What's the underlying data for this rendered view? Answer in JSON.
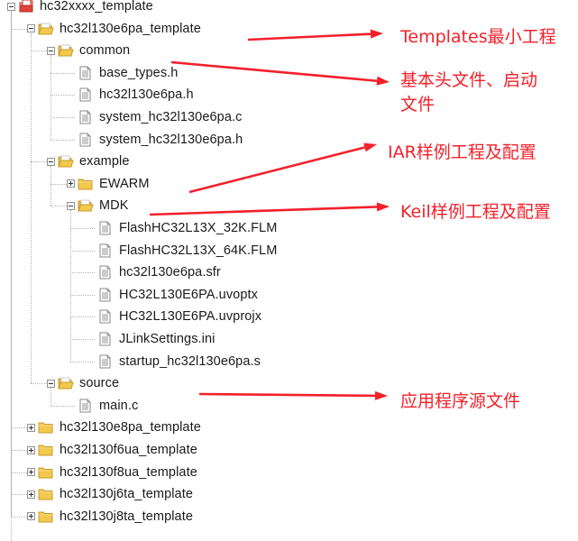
{
  "colors": {
    "annotation": "#f3202a",
    "folder": "#f2c94c",
    "root_icon": "#e0433a"
  },
  "tree": [
    {
      "label": "hc32xxxx_template",
      "level": 0,
      "icon": "project-icon",
      "expander": "minus"
    },
    {
      "label": "hc32l130e6pa_template",
      "level": 1,
      "icon": "folder-open-icon",
      "expander": "minus"
    },
    {
      "label": "common",
      "level": 2,
      "icon": "folder-open-icon",
      "expander": "minus"
    },
    {
      "label": "base_types.h",
      "level": 3,
      "icon": "file-icon"
    },
    {
      "label": "hc32l130e6pa.h",
      "level": 3,
      "icon": "file-icon"
    },
    {
      "label": "system_hc32l130e6pa.c",
      "level": 3,
      "icon": "file-icon"
    },
    {
      "label": "system_hc32l130e6pa.h",
      "level": 3,
      "icon": "file-icon"
    },
    {
      "label": "example",
      "level": 2,
      "icon": "folder-open-icon",
      "expander": "minus"
    },
    {
      "label": "EWARM",
      "level": 3,
      "icon": "folder-icon",
      "expander": "plus"
    },
    {
      "label": "MDK",
      "level": 3,
      "icon": "folder-open-icon",
      "expander": "minus"
    },
    {
      "label": "FlashHC32L13X_32K.FLM",
      "level": 4,
      "icon": "file-icon"
    },
    {
      "label": "FlashHC32L13X_64K.FLM",
      "level": 4,
      "icon": "file-icon"
    },
    {
      "label": "hc32l130e6pa.sfr",
      "level": 4,
      "icon": "file-icon"
    },
    {
      "label": "HC32L130E6PA.uvoptx",
      "level": 4,
      "icon": "file-icon"
    },
    {
      "label": "HC32L130E6PA.uvprojx",
      "level": 4,
      "icon": "file-icon"
    },
    {
      "label": "JLinkSettings.ini",
      "level": 4,
      "icon": "file-icon"
    },
    {
      "label": "startup_hc32l130e6pa.s",
      "level": 4,
      "icon": "file-icon"
    },
    {
      "label": "source",
      "level": 2,
      "icon": "folder-open-icon",
      "expander": "minus"
    },
    {
      "label": "main.c",
      "level": 3,
      "icon": "file-icon"
    },
    {
      "label": "hc32l130e8pa_template",
      "level": 1,
      "icon": "folder-icon",
      "expander": "plus"
    },
    {
      "label": "hc32l130f6ua_template",
      "level": 1,
      "icon": "folder-icon",
      "expander": "plus"
    },
    {
      "label": "hc32l130f8ua_template",
      "level": 1,
      "icon": "folder-icon",
      "expander": "plus"
    },
    {
      "label": "hc32l130j6ta_template",
      "level": 1,
      "icon": "folder-icon",
      "expander": "plus"
    },
    {
      "label": "hc32l130j8ta_template",
      "level": 1,
      "icon": "folder-icon",
      "expander": "plus"
    }
  ],
  "annotations": {
    "templates": "Templates最小工程",
    "common_line1": "基本头文件、启动",
    "common_line2": "文件",
    "iar": "IAR样例工程及配置",
    "keil": "Keil样例工程及配置",
    "source": "应用程序源文件"
  }
}
